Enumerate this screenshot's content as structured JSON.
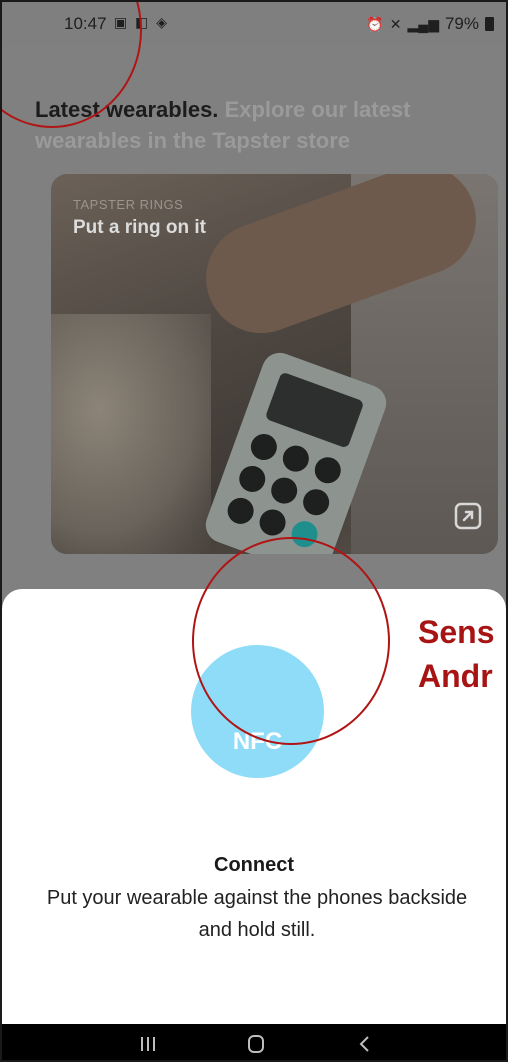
{
  "status_bar": {
    "time": "10:47",
    "battery": "79%"
  },
  "main": {
    "heading_bold": "Latest wearables.",
    "heading_sub": "Explore our latest wearables in the Tapster store",
    "card": {
      "eyebrow": "TAPSTER RINGS",
      "title": "Put a ring on it"
    }
  },
  "sheet": {
    "nfc_label": "NFC",
    "title": "Connect",
    "text": "Put your wearable against the phones backside and hold still."
  },
  "annotation": {
    "text": "Sens\nAndr"
  },
  "colors": {
    "nfc_circle": "#8edcf7",
    "annotation": "#b01515"
  }
}
